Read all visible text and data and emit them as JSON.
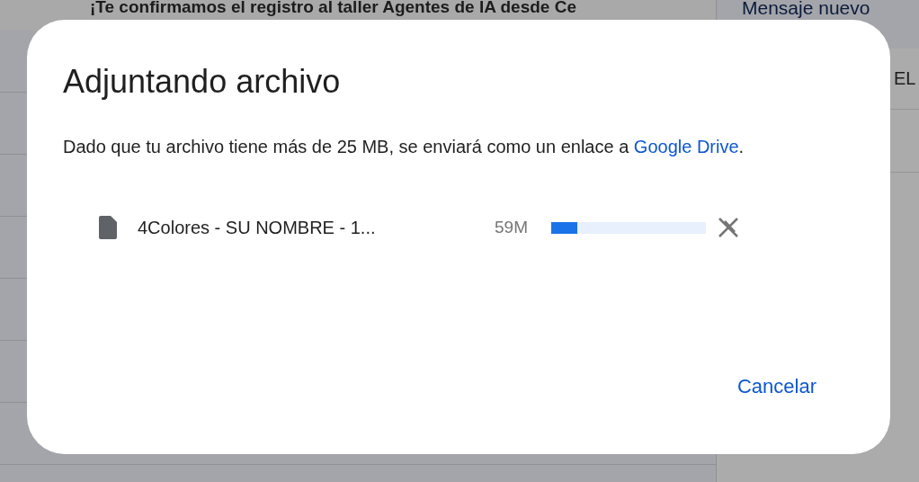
{
  "background": {
    "subject": "¡Te confirmamos el registro al taller Agentes de IA desde Ce",
    "compose_title": "Mensaje nuevo",
    "compose_field": "EL"
  },
  "dialog": {
    "title": "Adjuntando archivo",
    "message_before": "Dado que tu archivo tiene más de 25 MB, se enviará como un enlace a",
    "link": "Google Drive",
    "message_after": ".",
    "attachment": {
      "name": "4Colores - SU NOMBRE - 1...",
      "size": "59M",
      "level": 0.17
    },
    "buttons": [
      "Cancelar"
    ]
  }
}
